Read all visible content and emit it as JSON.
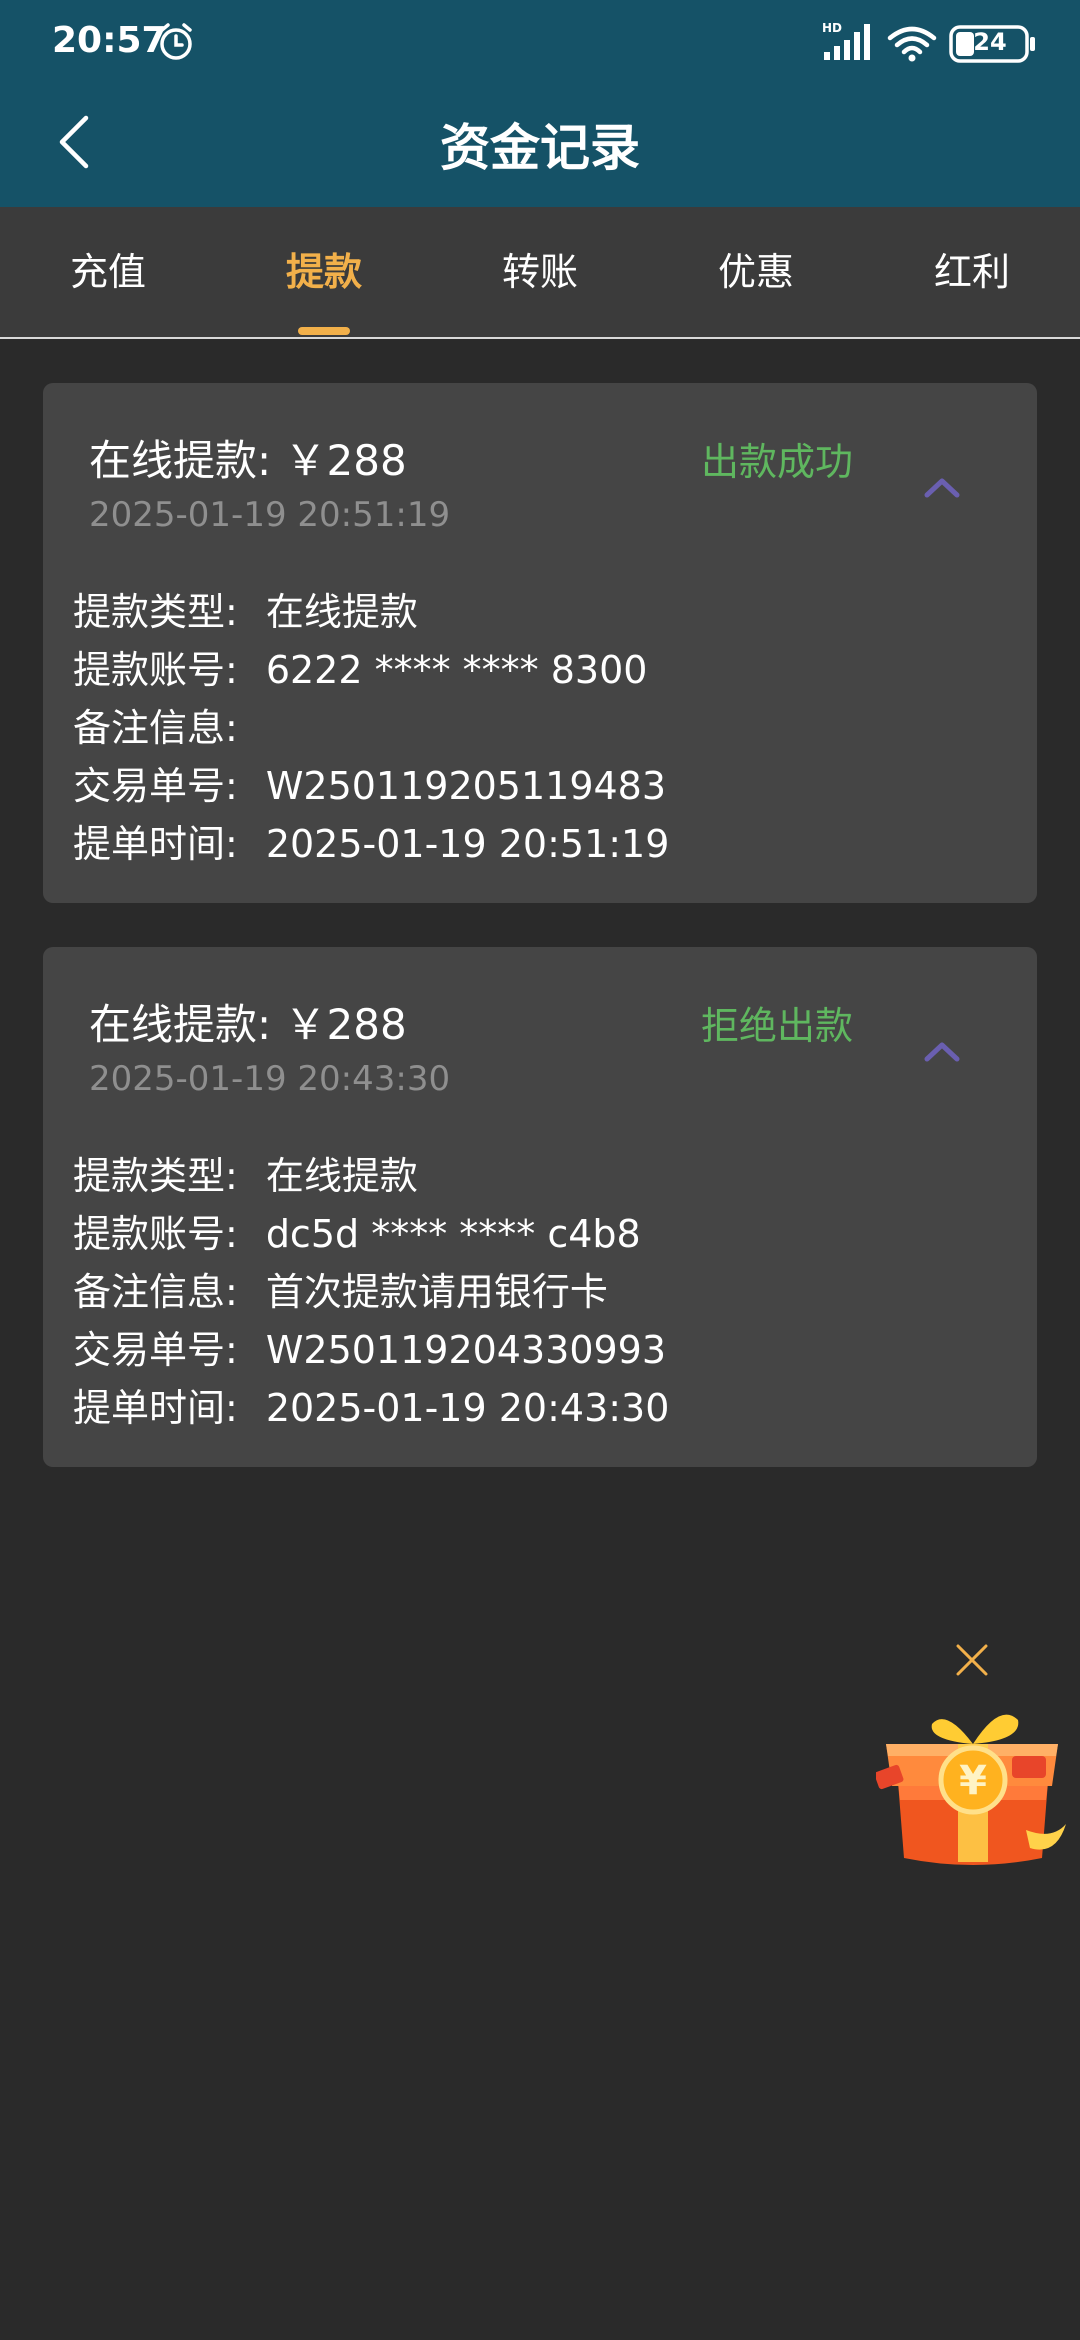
{
  "status_bar": {
    "time": "20:57",
    "battery": "24",
    "network_label": "HD"
  },
  "header": {
    "title": "资金记录"
  },
  "tabs": [
    {
      "label": "充值"
    },
    {
      "label": "提款",
      "active": true
    },
    {
      "label": "转账"
    },
    {
      "label": "优惠"
    },
    {
      "label": "红利"
    }
  ],
  "records": [
    {
      "title": "在线提款: ￥288",
      "date": "2025-01-19 20:51:19",
      "status": "出款成功",
      "status_color": "#5fb75f",
      "details": [
        {
          "label": "提款类型:",
          "value": "在线提款"
        },
        {
          "label": "提款账号:",
          "value": "6222 **** **** 8300"
        },
        {
          "label": "备注信息:",
          "value": ""
        },
        {
          "label": "交易单号:",
          "value": "W250119205119483"
        },
        {
          "label": "提单时间:",
          "value": "2025-01-19 20:51:19"
        }
      ]
    },
    {
      "title": "在线提款: ￥288",
      "date": "2025-01-19 20:43:30",
      "status": "拒绝出款",
      "status_color": "#5fb75f",
      "details": [
        {
          "label": "提款类型:",
          "value": "在线提款"
        },
        {
          "label": "提款账号:",
          "value": "dc5d **** **** c4b8"
        },
        {
          "label": "备注信息:",
          "value": "首次提款请用银行卡"
        },
        {
          "label": "交易单号:",
          "value": "W250119204330993"
        },
        {
          "label": "提单时间:",
          "value": "2025-01-19 20:43:30"
        }
      ]
    }
  ],
  "colors": {
    "header_bg": "#155267",
    "page_bg": "#2a2a2a",
    "tab_bg": "#3b3b3b",
    "card_bg": "#454545",
    "accent": "#f2b04a",
    "chevron": "#6a5fb0"
  },
  "icons": {
    "back": "chevron-left-icon",
    "expand": "chevron-up-icon",
    "float_close": "close-icon",
    "float_gift": "gift-box-icon"
  }
}
